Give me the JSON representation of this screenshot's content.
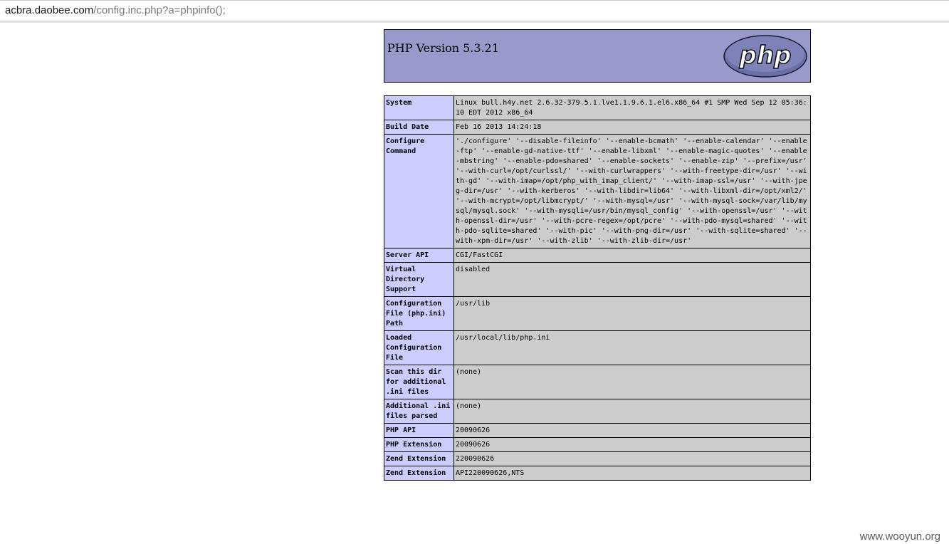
{
  "browser": {
    "url_host": "acbra.daobee.com",
    "url_path": "/config.inc.php?a=phpinfo();"
  },
  "header": {
    "title": "PHP Version 5.3.21",
    "logo_text": "php"
  },
  "rows": [
    {
      "label": "System",
      "value": "Linux bull.h4y.net 2.6.32-379.5.1.lve1.1.9.6.1.el6.x86_64 #1 SMP Wed Sep 12 05:36:10 EDT 2012 x86_64"
    },
    {
      "label": "Build Date",
      "value": "Feb 16 2013 14:24:18"
    },
    {
      "label": "Configure Command",
      "value": "'./configure' '--disable-fileinfo' '--enable-bcmath' '--enable-calendar' '--enable-ftp' '--enable-gd-native-ttf' '--enable-libxml' '--enable-magic-quotes' '--enable-mbstring' '--enable-pdo=shared' '--enable-sockets' '--enable-zip' '--prefix=/usr' '--with-curl=/opt/curlssl/' '--with-curlwrappers' '--with-freetype-dir=/usr' '--with-gd' '--with-imap=/opt/php_with_imap_client/' '--with-imap-ssl=/usr' '--with-jpeg-dir=/usr' '--with-kerberos' '--with-libdir=lib64' '--with-libxml-dir=/opt/xml2/' '--with-mcrypt=/opt/libmcrypt/' '--with-mysql=/usr' '--with-mysql-sock=/var/lib/mysql/mysql.sock' '--with-mysqli=/usr/bin/mysql_config' '--with-openssl=/usr' '--with-openssl-dir=/usr' '--with-pcre-regex=/opt/pcre' '--with-pdo-mysql=shared' '--with-pdo-sqlite=shared' '--with-pic' '--with-png-dir=/usr' '--with-sqlite=shared' '--with-xpm-dir=/usr' '--with-zlib' '--with-zlib-dir=/usr'"
    },
    {
      "label": "Server API",
      "value": "CGI/FastCGI"
    },
    {
      "label": "Virtual Directory Support",
      "value": "disabled"
    },
    {
      "label": "Configuration File (php.ini) Path",
      "value": "/usr/lib"
    },
    {
      "label": "Loaded Configuration File",
      "value": "/usr/local/lib/php.ini"
    },
    {
      "label": "Scan this dir for additional .ini files",
      "value": "(none)"
    },
    {
      "label": "Additional .ini files parsed",
      "value": "(none)"
    },
    {
      "label": "PHP API",
      "value": "20090626"
    },
    {
      "label": "PHP Extension",
      "value": "20090626"
    },
    {
      "label": "Zend Extension",
      "value": "220090626"
    },
    {
      "label": "Zend Extension",
      "value": "API220090626,NTS"
    }
  ],
  "watermark": "www.wooyun.org",
  "colors": {
    "header_bg": "#9999cc",
    "label_bg": "#ccccff",
    "value_bg": "#cccccc"
  }
}
